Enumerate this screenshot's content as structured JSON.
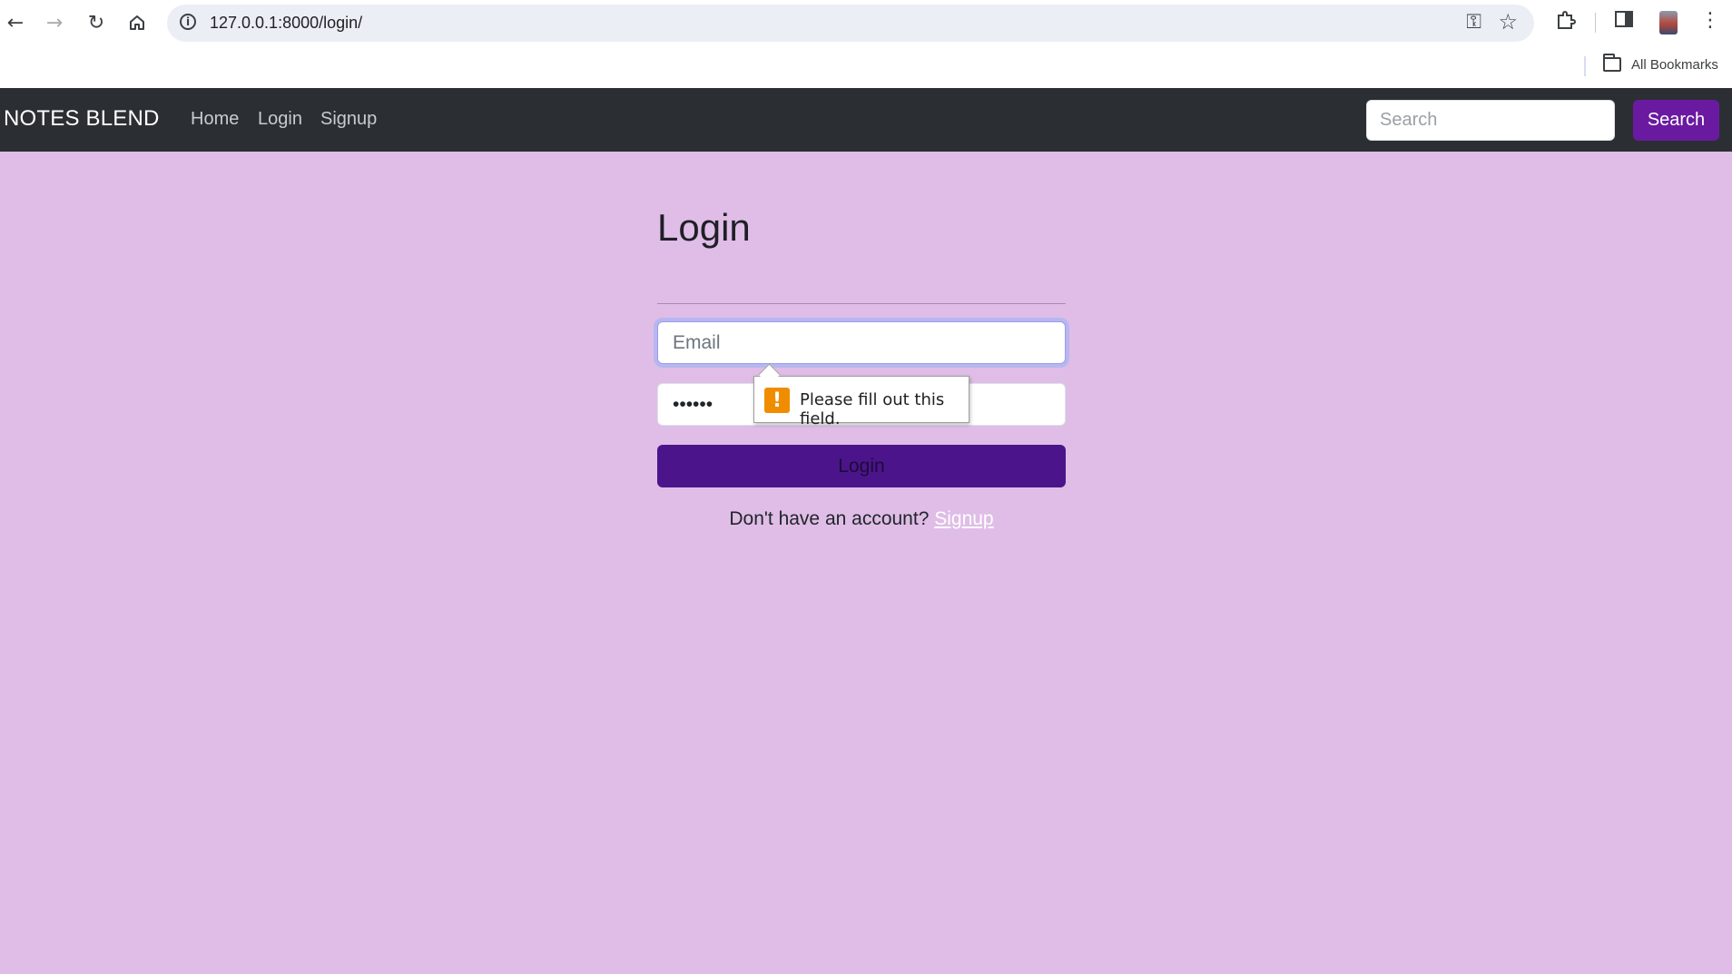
{
  "browser": {
    "url": "127.0.0.1:8000/login/",
    "bookmarks_label": "All Bookmarks",
    "icons": [
      "back-icon",
      "forward-icon",
      "reload-icon",
      "home-icon",
      "site-info-icon",
      "password-key-icon",
      "bookmark-star-icon",
      "extensions-icon",
      "side-panel-icon",
      "profile-avatar",
      "menu-icon",
      "folder-icon"
    ]
  },
  "navbar": {
    "brand": "NOTES BLEND",
    "links": [
      "Home",
      "Login",
      "Signup"
    ],
    "search_placeholder": "Search",
    "search_button": "Search"
  },
  "login_form": {
    "title": "Login",
    "email_placeholder": "Email",
    "email_value": "",
    "password_value": "••••••",
    "submit_label": "Login",
    "signup_prompt": "Don't have an account?",
    "signup_link": "Signup"
  },
  "validation": {
    "message": "Please fill out this field.",
    "icon": "!"
  },
  "colors": {
    "navbar_bg": "#2b2f33",
    "page_bg": "#dfbde7",
    "primary_button": "#4b148b",
    "search_button": "#6a1aa0",
    "warning": "#f08c00"
  }
}
